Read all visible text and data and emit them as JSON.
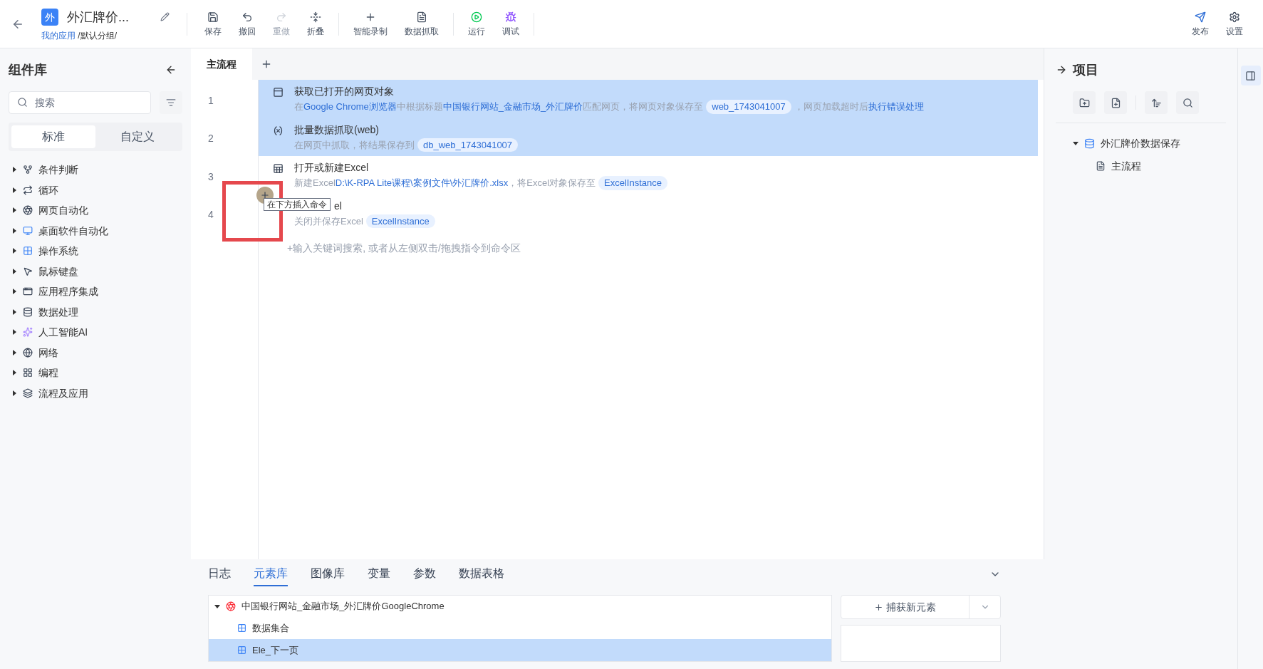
{
  "header": {
    "logo": "外",
    "title": "外汇牌价...",
    "breadcrumb_link": "我的应用",
    "breadcrumb_rest": "/默认分组/"
  },
  "toolbar": [
    {
      "label": "保存",
      "disabled": false
    },
    {
      "label": "撤回",
      "disabled": false
    },
    {
      "label": "重做",
      "disabled": true
    },
    {
      "label": "折叠",
      "disabled": false
    },
    {
      "label": "智能录制",
      "disabled": false
    },
    {
      "label": "数据抓取",
      "disabled": false
    },
    {
      "label": "运行",
      "disabled": false
    },
    {
      "label": "调试",
      "disabled": false
    }
  ],
  "toolbar_right": [
    {
      "label": "发布"
    },
    {
      "label": "设置"
    }
  ],
  "sidebar": {
    "title": "组件库",
    "search": {
      "placeholder": "搜索"
    },
    "tabs": [
      {
        "label": "标准",
        "selected": true
      },
      {
        "label": "自定义",
        "selected": false
      }
    ],
    "items": [
      {
        "label": "条件判断"
      },
      {
        "label": "循环"
      },
      {
        "label": "网页自动化"
      },
      {
        "label": "桌面软件自动化"
      },
      {
        "label": "操作系统"
      },
      {
        "label": "鼠标键盘"
      },
      {
        "label": "应用程序集成"
      },
      {
        "label": "数据处理"
      },
      {
        "label": "人工智能AI"
      },
      {
        "label": "网络"
      },
      {
        "label": "编程"
      },
      {
        "label": "流程及应用"
      }
    ]
  },
  "flow_tabs": [
    {
      "label": "主流程",
      "selected": true
    }
  ],
  "steps": [
    {
      "number": "1",
      "title": "获取已打开的网页对象",
      "selected": true,
      "desc": [
        {
          "kind": "text",
          "text": "在"
        },
        {
          "kind": "link",
          "text": "Google Chrome浏览器"
        },
        {
          "kind": "text",
          "text": "中根据标题"
        },
        {
          "kind": "link",
          "text": "中国银行网站_金融市场_外汇牌价"
        },
        {
          "kind": "text",
          "text": "匹配网页，将网页对象保存至"
        },
        {
          "kind": "var",
          "text": "web_1743041007"
        },
        {
          "kind": "text",
          "text": "，网页加载超时后"
        },
        {
          "kind": "link",
          "text": "执行错误处理"
        }
      ]
    },
    {
      "number": "2",
      "title": "批量数据抓取(web)",
      "selected": true,
      "desc": [
        {
          "kind": "text",
          "text": "在网页中抓取，将结果保存到"
        },
        {
          "kind": "var",
          "text": "db_web_1743041007"
        }
      ]
    },
    {
      "number": "3",
      "title": "打开或新建Excel",
      "selected": false,
      "desc": [
        {
          "kind": "text",
          "text": "新建Excel"
        },
        {
          "kind": "link",
          "text": "D:\\K-RPA Lite课程\\案例文件\\外汇牌价.xlsx"
        },
        {
          "kind": "text",
          "text": "，将Excel对象保存至"
        },
        {
          "kind": "var",
          "text": "ExcelInstance"
        }
      ]
    },
    {
      "number": "4",
      "title": "el",
      "selected": false,
      "desc": [
        {
          "kind": "text",
          "text": "关闭并保存Excel"
        },
        {
          "kind": "var",
          "text": "ExcelInstance"
        }
      ]
    }
  ],
  "add_hint": "+输入关键词搜索, 或者从左侧双击/拖拽指令到命令区",
  "tooltip": "在下方插入命令",
  "project": {
    "title": "项目",
    "tree": [
      {
        "label": "外汇牌价数据保存",
        "expanded": true,
        "children": [
          {
            "label": "主流程"
          }
        ]
      }
    ]
  },
  "bottom_tabs": [
    {
      "label": "日志",
      "selected": false
    },
    {
      "label": "元素库",
      "selected": true
    },
    {
      "label": "图像库",
      "selected": false
    },
    {
      "label": "变量",
      "selected": false
    },
    {
      "label": "参数",
      "selected": false
    },
    {
      "label": "数据表格",
      "selected": false
    }
  ],
  "elements": [
    {
      "label": "中国银行网站_金融市场_外汇牌价GoogleChrome",
      "expanded": true,
      "children": [
        {
          "label": "数据集合",
          "selected": false
        },
        {
          "label": "Ele_下一页",
          "selected": true
        }
      ]
    }
  ],
  "capture_button": "捕获新元素"
}
